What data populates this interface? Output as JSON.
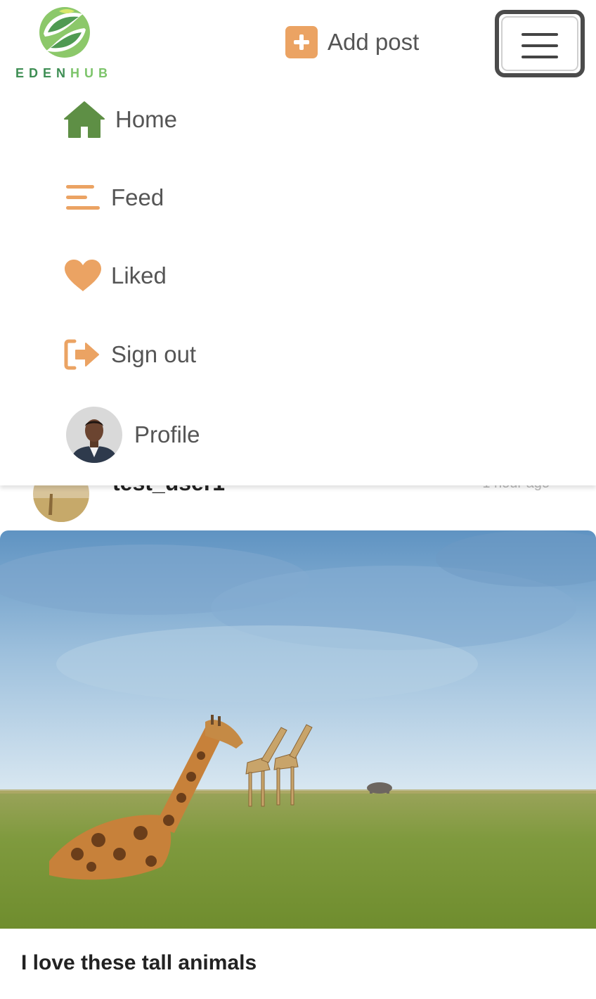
{
  "brand": {
    "name_part1": "EDEN",
    "name_part2": "HUB",
    "accent_orange": "#eba363",
    "accent_green": "#6b9b4c"
  },
  "header": {
    "add_post_label": "Add post",
    "add_post_icon": "plus-square-icon",
    "menu_icon": "hamburger-icon"
  },
  "nav": {
    "items": [
      {
        "label": "Home",
        "icon": "home-icon"
      },
      {
        "label": "Feed",
        "icon": "feed-lines-icon"
      },
      {
        "label": "Liked",
        "icon": "heart-icon"
      },
      {
        "label": "Sign out",
        "icon": "sign-out-icon"
      },
      {
        "label": "Profile",
        "icon": "avatar"
      }
    ]
  },
  "post": {
    "username": "test_user1",
    "timestamp": "1 hour ago",
    "image_alt": "Giraffes on a grassy savanna",
    "caption": "I love these tall animals"
  }
}
